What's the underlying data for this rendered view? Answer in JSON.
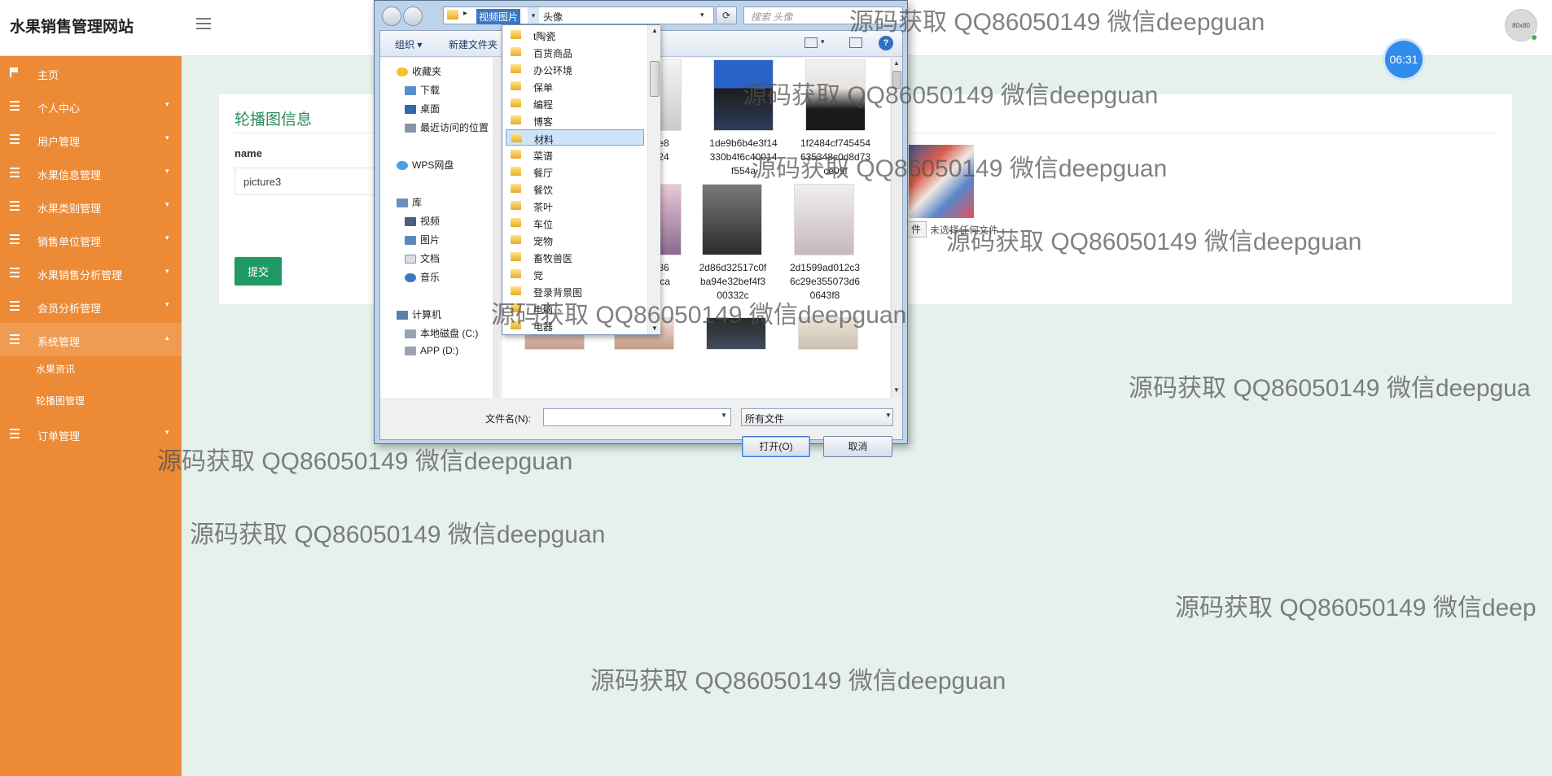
{
  "header": {
    "brand": "水果销售管理网站",
    "avatar_text": "80x80",
    "clock": "06:31"
  },
  "sidebar": {
    "items": [
      {
        "label": "主页"
      },
      {
        "label": "个人中心"
      },
      {
        "label": "用户管理"
      },
      {
        "label": "水果信息管理"
      },
      {
        "label": "水果类别管理"
      },
      {
        "label": "销售单位管理"
      },
      {
        "label": "水果销售分析管理"
      },
      {
        "label": "会员分析管理"
      },
      {
        "label": "系统管理"
      },
      {
        "label": "订单管理"
      }
    ],
    "sub_items": [
      {
        "label": "水果资讯"
      },
      {
        "label": "轮播图管理"
      }
    ]
  },
  "main": {
    "title": "轮播图信息",
    "name_label": "name",
    "name_value": "picture3",
    "submit": "提交",
    "upload_btn": "件",
    "no_file": "未选择任何文件"
  },
  "dialog": {
    "crumb_parent": "视频图片",
    "crumb_current": "头像",
    "search_placeholder": "搜索 头像",
    "toolbar": {
      "organize": "组织 ▾",
      "new_folder": "新建文件夹"
    },
    "tree": [
      {
        "label": "收藏夹"
      },
      {
        "label": "下载"
      },
      {
        "label": "桌面"
      },
      {
        "label": "最近访问的位置"
      },
      {
        "label": "WPS网盘"
      },
      {
        "label": "库"
      },
      {
        "label": "视频"
      },
      {
        "label": "图片"
      },
      {
        "label": "文档"
      },
      {
        "label": "音乐"
      },
      {
        "label": "计算机"
      },
      {
        "label": "本地磁盘 (C:)"
      },
      {
        "label": "APP (D:)"
      }
    ],
    "files": [
      {
        "name1": "6a6e8",
        "name2": "04b24",
        "name3": "af"
      },
      {
        "name1": "1de9b6b4e3f14",
        "name2": "330b4f6c40014",
        "name3": "f554a"
      },
      {
        "name1": "1f2484cf745454",
        "name2": "635348c0d8d73",
        "name3": "ce09f"
      },
      {
        "name1": "63d86",
        "name2": "450fca",
        "name3": "e3"
      },
      {
        "name1": "2d86d32517c0f",
        "name2": "ba94e32bef4f3",
        "name3": "00332c"
      },
      {
        "name1": "2d1599ad012c3",
        "name2": "6c29e355073d6",
        "name3": "0643f8"
      }
    ],
    "folders": [
      {
        "label": "t陶瓷"
      },
      {
        "label": "百货商品"
      },
      {
        "label": "办公环境"
      },
      {
        "label": "保单"
      },
      {
        "label": "编程"
      },
      {
        "label": "博客"
      },
      {
        "label": "材料"
      },
      {
        "label": "菜谱"
      },
      {
        "label": "餐厅"
      },
      {
        "label": "餐饮"
      },
      {
        "label": "茶叶"
      },
      {
        "label": "车位"
      },
      {
        "label": "宠物"
      },
      {
        "label": "畜牧兽医"
      },
      {
        "label": "党"
      },
      {
        "label": "登录背景图"
      },
      {
        "label": "电脑"
      },
      {
        "label": "电器"
      }
    ],
    "filename_label": "文件名(N):",
    "filetype": "所有文件",
    "open": "打开(O)",
    "cancel": "取消"
  },
  "watermark": "源码获取 QQ86050149 微信deepguan",
  "watermark_cut1": "源码获取 QQ86050149 微信deepgua",
  "watermark_cut2": "源码获取 QQ86050149 微信deep",
  "colors": {
    "sidebar": "#ec8a36",
    "accent": "#1f9a63",
    "background": "#e6f1ec",
    "clock": "#2f8cea"
  }
}
